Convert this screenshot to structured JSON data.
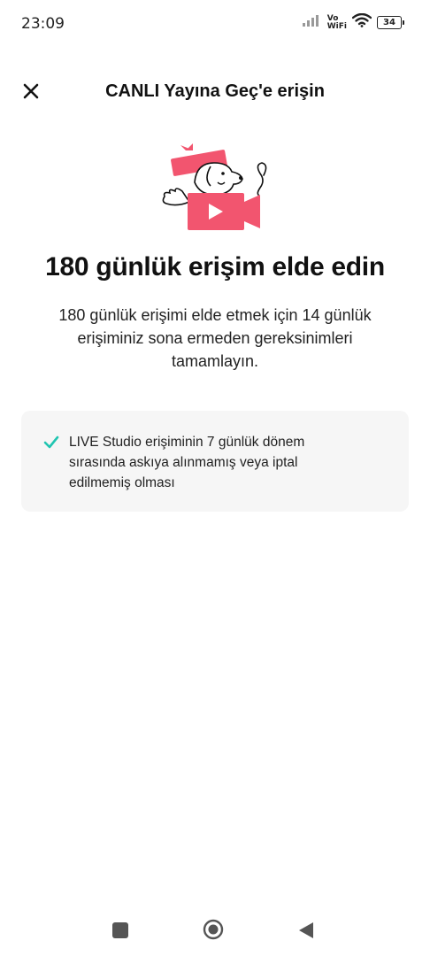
{
  "status_bar": {
    "time": "23:09",
    "vo_label": "Vo",
    "wifi_label": "WiFi",
    "battery_level": "34"
  },
  "header": {
    "title": "CANLI Yayına Geç'e erişin",
    "close_icon": "close-icon"
  },
  "hero": {
    "title": "180 günlük erişim elde edin",
    "description": "180 günlük erişimi elde etmek için 14 günlük erişiminiz sona ermeden gereksinimleri tamamlayın.",
    "illustration": "dog-in-gift-box-with-video-camera",
    "accent_color": "#f2556f"
  },
  "requirements": [
    {
      "icon": "check-icon",
      "icon_color": "#20c5b1",
      "text": "LIVE Studio erişiminin 7 günlük dönem sırasında askıya alınmamış veya iptal edilmemiş olması"
    }
  ],
  "nav_bar": {
    "recents": "square-icon",
    "home": "circle-home-icon",
    "back": "back-triangle-icon"
  }
}
